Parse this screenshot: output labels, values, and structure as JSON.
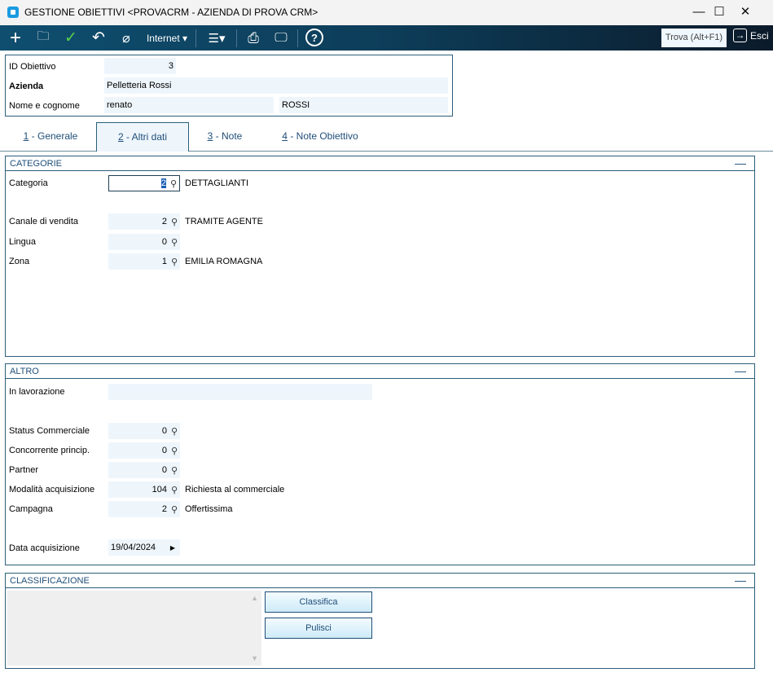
{
  "window": {
    "title": "GESTIONE OBIETTIVI <PROVACRM - AZIENDA DI PROVA CRM>",
    "minimize": "—",
    "maximize": "☐",
    "close": "✕"
  },
  "toolbar": {
    "internet_label": "Internet ▾",
    "menu_label": "☰▾",
    "search_label": "Trova (Alt+F1)",
    "exit_label": "Esci"
  },
  "header": {
    "id_label": "ID Obiettivo",
    "id_value": "3",
    "azienda_label": "Azienda",
    "azienda_value": "Pelletteria Rossi",
    "nome_label": "Nome e cognome",
    "nome_value": "renato",
    "cognome_value": "ROSSI"
  },
  "tabs": [
    {
      "num": "1",
      "label": " - Generale"
    },
    {
      "num": "2",
      "label": " - Altri dati"
    },
    {
      "num": "3",
      "label": " - Note"
    },
    {
      "num": "4",
      "label": " - Note Obiettivo"
    }
  ],
  "categorie": {
    "title": "CATEGORIE",
    "fields": [
      {
        "label": "Categoria",
        "value": "2",
        "desc": "DETTAGLIANTI"
      },
      {
        "label": "Canale di vendita",
        "value": "2",
        "desc": "TRAMITE AGENTE"
      },
      {
        "label": "Lingua",
        "value": "0",
        "desc": ""
      },
      {
        "label": "Zona",
        "value": "1",
        "desc": "EMILIA ROMAGNA"
      }
    ]
  },
  "altro": {
    "title": "ALTRO",
    "in_lavorazione_label": "In lavorazione",
    "in_lavorazione_value": "",
    "fields": [
      {
        "label": "Status Commerciale",
        "value": "0",
        "desc": ""
      },
      {
        "label": "Concorrente princip.",
        "value": "0",
        "desc": ""
      },
      {
        "label": "Partner",
        "value": "0",
        "desc": ""
      },
      {
        "label": "Modalità acquisizione",
        "value": "104",
        "desc": "Richiesta al commerciale"
      },
      {
        "label": "Campagna",
        "value": "2",
        "desc": "Offertissima"
      }
    ],
    "data_label": "Data acquisizione",
    "data_value": "19/04/2024"
  },
  "classificazione": {
    "title": "CLASSIFICAZIONE",
    "classifica_label": "Classifica",
    "pulisci_label": "Pulisci"
  }
}
